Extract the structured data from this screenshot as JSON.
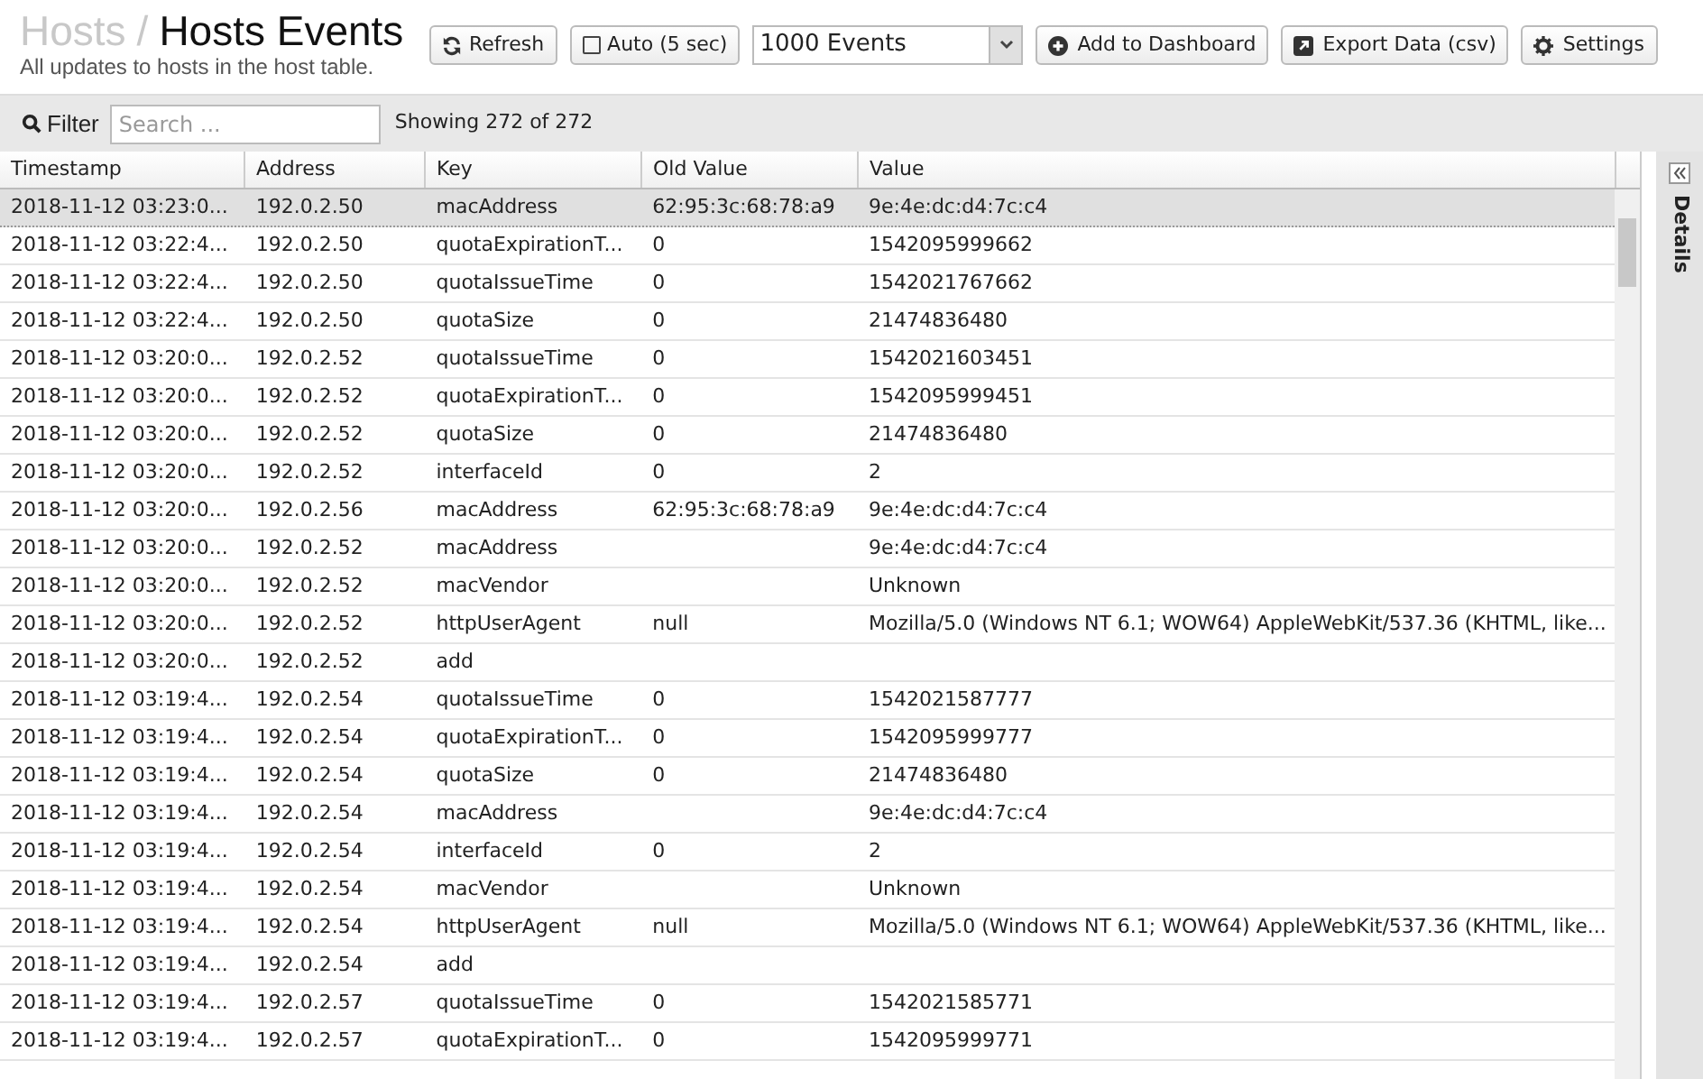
{
  "header": {
    "breadcrumb_parent": "Hosts",
    "separator": "/",
    "title": "Hosts Events",
    "subtitle": "All updates to hosts in the host table."
  },
  "toolbar": {
    "refresh": "Refresh",
    "auto": {
      "label": "Auto (5 sec)",
      "checked": false
    },
    "limit": "1000 Events",
    "add_dashboard": "Add to Dashboard",
    "export": "Export Data (csv)",
    "settings": "Settings"
  },
  "filter": {
    "label": "Filter",
    "placeholder": "Search ...",
    "count": "Showing 272 of 272"
  },
  "table": {
    "columns": [
      "Timestamp",
      "Address",
      "Key",
      "Old Value",
      "Value"
    ],
    "rows": [
      {
        "selected": true,
        "cells": [
          "2018-11-12 03:23:0...",
          "192.0.2.50",
          "macAddress",
          "62:95:3c:68:78:a9",
          "9e:4e:dc:d4:7c:c4"
        ]
      },
      {
        "selected": false,
        "cells": [
          "2018-11-12 03:22:4...",
          "192.0.2.50",
          "quotaExpirationT...",
          "0",
          "1542095999662"
        ]
      },
      {
        "selected": false,
        "cells": [
          "2018-11-12 03:22:4...",
          "192.0.2.50",
          "quotaIssueTime",
          "0",
          "1542021767662"
        ]
      },
      {
        "selected": false,
        "cells": [
          "2018-11-12 03:22:4...",
          "192.0.2.50",
          "quotaSize",
          "0",
          "21474836480"
        ]
      },
      {
        "selected": false,
        "cells": [
          "2018-11-12 03:20:0...",
          "192.0.2.52",
          "quotaIssueTime",
          "0",
          "1542021603451"
        ]
      },
      {
        "selected": false,
        "cells": [
          "2018-11-12 03:20:0...",
          "192.0.2.52",
          "quotaExpirationT...",
          "0",
          "1542095999451"
        ]
      },
      {
        "selected": false,
        "cells": [
          "2018-11-12 03:20:0...",
          "192.0.2.52",
          "quotaSize",
          "0",
          "21474836480"
        ]
      },
      {
        "selected": false,
        "cells": [
          "2018-11-12 03:20:0...",
          "192.0.2.52",
          "interfaceId",
          "0",
          "2"
        ]
      },
      {
        "selected": false,
        "cells": [
          "2018-11-12 03:20:0...",
          "192.0.2.56",
          "macAddress",
          "62:95:3c:68:78:a9",
          "9e:4e:dc:d4:7c:c4"
        ]
      },
      {
        "selected": false,
        "cells": [
          "2018-11-12 03:20:0...",
          "192.0.2.52",
          "macAddress",
          "",
          "9e:4e:dc:d4:7c:c4"
        ]
      },
      {
        "selected": false,
        "cells": [
          "2018-11-12 03:20:0...",
          "192.0.2.52",
          "macVendor",
          "",
          "Unknown"
        ]
      },
      {
        "selected": false,
        "cells": [
          "2018-11-12 03:20:0...",
          "192.0.2.52",
          "httpUserAgent",
          "null",
          "Mozilla/5.0 (Windows NT 6.1; WOW64) AppleWebKit/537.36 (KHTML, like..."
        ]
      },
      {
        "selected": false,
        "cells": [
          "2018-11-12 03:20:0...",
          "192.0.2.52",
          "add",
          "",
          ""
        ]
      },
      {
        "selected": false,
        "cells": [
          "2018-11-12 03:19:4...",
          "192.0.2.54",
          "quotaIssueTime",
          "0",
          "1542021587777"
        ]
      },
      {
        "selected": false,
        "cells": [
          "2018-11-12 03:19:4...",
          "192.0.2.54",
          "quotaExpirationT...",
          "0",
          "1542095999777"
        ]
      },
      {
        "selected": false,
        "cells": [
          "2018-11-12 03:19:4...",
          "192.0.2.54",
          "quotaSize",
          "0",
          "21474836480"
        ]
      },
      {
        "selected": false,
        "cells": [
          "2018-11-12 03:19:4...",
          "192.0.2.54",
          "macAddress",
          "",
          "9e:4e:dc:d4:7c:c4"
        ]
      },
      {
        "selected": false,
        "cells": [
          "2018-11-12 03:19:4...",
          "192.0.2.54",
          "interfaceId",
          "0",
          "2"
        ]
      },
      {
        "selected": false,
        "cells": [
          "2018-11-12 03:19:4...",
          "192.0.2.54",
          "macVendor",
          "",
          "Unknown"
        ]
      },
      {
        "selected": false,
        "cells": [
          "2018-11-12 03:19:4...",
          "192.0.2.54",
          "httpUserAgent",
          "null",
          "Mozilla/5.0 (Windows NT 6.1; WOW64) AppleWebKit/537.36 (KHTML, like..."
        ]
      },
      {
        "selected": false,
        "cells": [
          "2018-11-12 03:19:4...",
          "192.0.2.54",
          "add",
          "",
          ""
        ]
      },
      {
        "selected": false,
        "cells": [
          "2018-11-12 03:19:4...",
          "192.0.2.57",
          "quotaIssueTime",
          "0",
          "1542021585771"
        ]
      },
      {
        "selected": false,
        "cells": [
          "2018-11-12 03:19:4...",
          "192.0.2.57",
          "quotaExpirationT...",
          "0",
          "1542095999771"
        ]
      }
    ]
  },
  "details_panel": {
    "label": "Details"
  }
}
